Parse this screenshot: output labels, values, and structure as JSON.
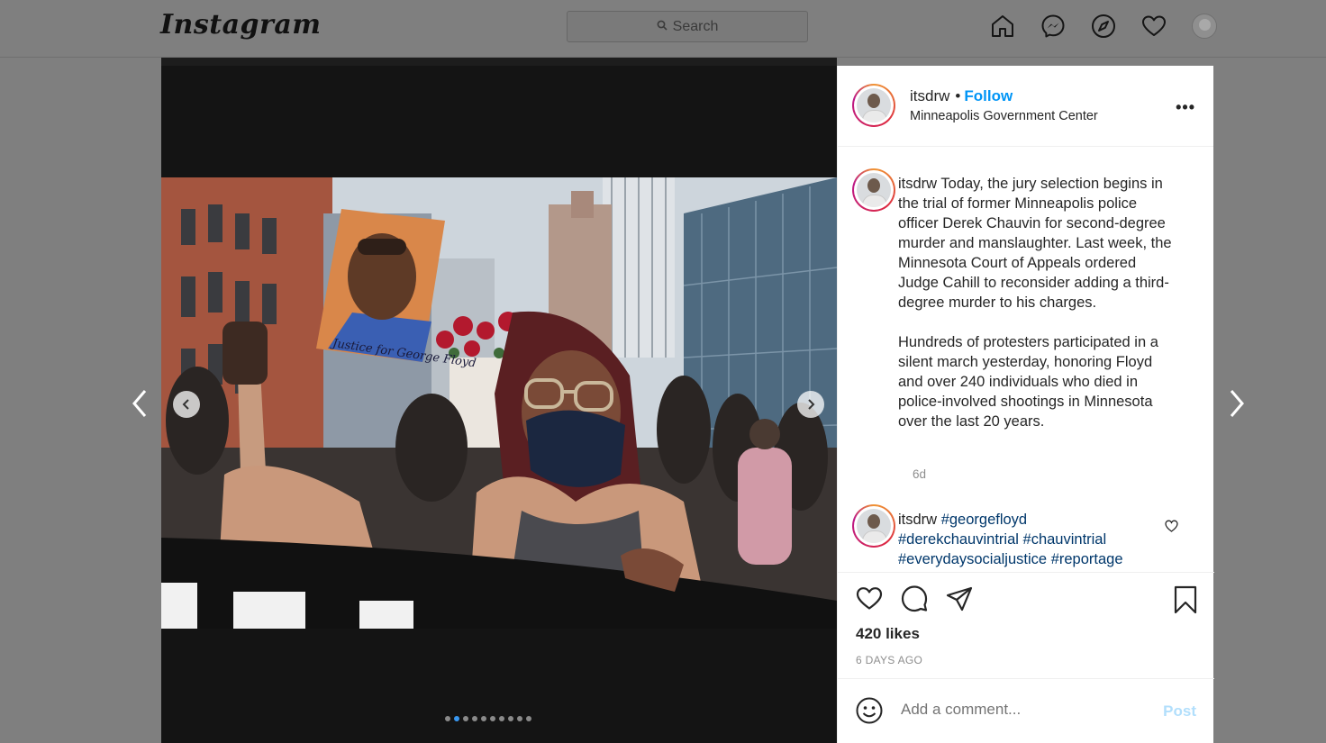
{
  "nav": {
    "logo": "Instagram",
    "search_placeholder": "Search",
    "icons": [
      "home-icon",
      "messenger-icon",
      "explore-icon",
      "heart-icon",
      "profile-avatar"
    ]
  },
  "post": {
    "username": "itsdrw",
    "follow_label": "Follow",
    "location": "Minneapolis Government Center",
    "more_label": "•••",
    "carousel": {
      "total_slides": 10,
      "active_slide": 2
    },
    "caption": {
      "username": "itsdrw",
      "text": "Today, the jury selection begins in the trial of former Minneapolis police officer Derek Chauvin for second-degree murder and manslaughter. Last week, the Minnesota Court of Appeals ordered Judge Cahill to reconsider adding a third-degree murder to his charges.\n\nHundreds of protesters participated in a silent march yesterday, honoring Floyd and over 240 individuals who died in police-involved shootings in Minnesota over the last 20 years.",
      "time": "6d"
    },
    "comment": {
      "username": "itsdrw",
      "hashtags": [
        "#georgefloyd",
        "#derekchauvintrial",
        "#chauvintrial",
        "#everydaysocialjustice",
        "#reportage"
      ]
    },
    "likes": "420 likes",
    "time_ago": "6 DAYS AGO",
    "add_comment_placeholder": "Add a comment...",
    "post_label": "Post",
    "sign_text": "Justice for George Floyd"
  },
  "colors": {
    "accent": "#0095f6",
    "hashtag": "#00376b",
    "overlay": "#7f7f7f"
  }
}
